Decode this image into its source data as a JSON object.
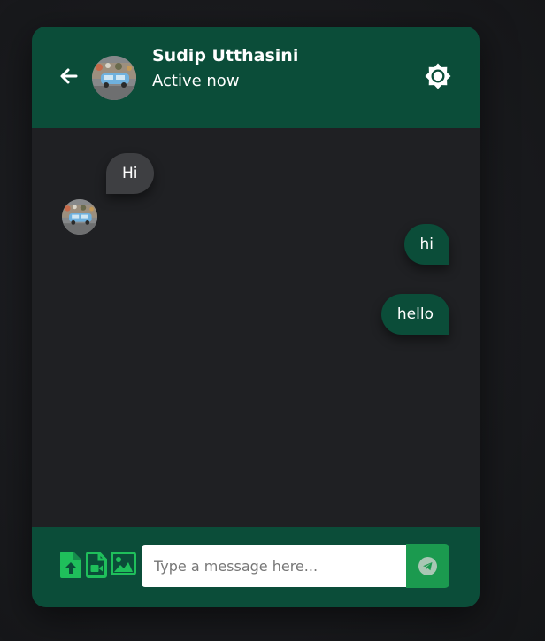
{
  "header": {
    "user_name": "Sudip Utthasini",
    "status": "Active now",
    "back_icon": "arrow-left-icon",
    "theme_icon": "sun-icon"
  },
  "messages": [
    {
      "direction": "incoming",
      "text": "Hi"
    },
    {
      "direction": "outgoing",
      "text": "hi"
    },
    {
      "direction": "outgoing",
      "text": "hello"
    }
  ],
  "footer": {
    "input_value": "",
    "input_placeholder": "Type a message here...",
    "attach_icons": [
      "file-upload-icon",
      "video-file-icon",
      "image-icon"
    ],
    "send_icon": "paper-plane-icon"
  },
  "colors": {
    "header_bg": "#0b4d39",
    "outgoing_bubble": "#0b4d39",
    "incoming_bubble": "#3e3f42",
    "send_button": "#1b9a4f",
    "attach_icon": "#1fbf5b"
  }
}
